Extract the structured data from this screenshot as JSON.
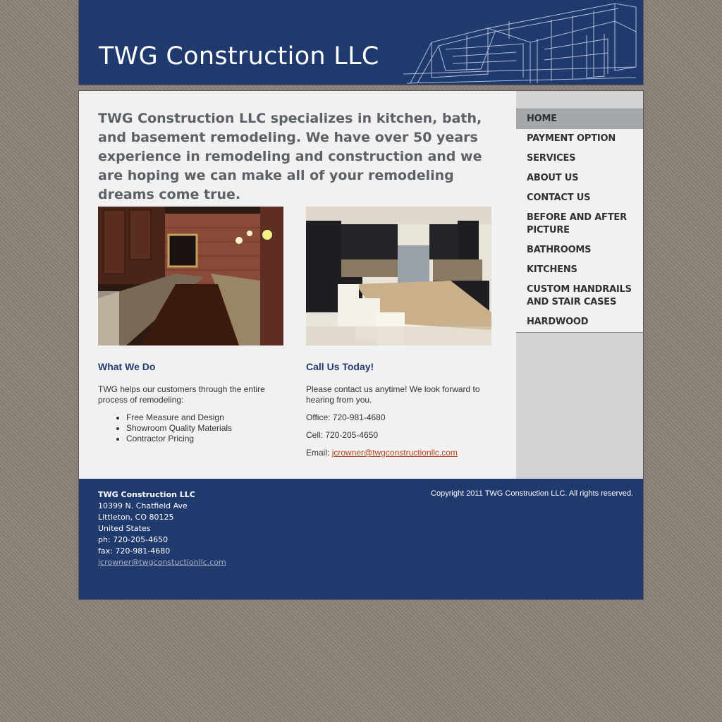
{
  "header": {
    "title": "TWG Construction LLC"
  },
  "intro": "TWG Construction LLC specializes in kitchen, bath, and basement remodeling.  We have over 50 years experience in remodeling and construction and we are hoping we can make all of your remodeling dreams come true.",
  "what_we_do": {
    "heading": "What We Do",
    "text": "TWG helps our customers through the entire process of remodeling:",
    "items": [
      "Free Measure and Design",
      "Showroom Quality Materials",
      "Contractor Pricing"
    ]
  },
  "call_us": {
    "heading": "Call Us Today!",
    "text": "Please contact us anytime! We look forward to hearing from you.",
    "office": "Office: 720-981-4680",
    "cell": "Cell: 720-205-4650",
    "email_label": "Email: ",
    "email": "jcrowner@twgconstructionllc.com"
  },
  "nav": {
    "items": [
      {
        "label": "HOME"
      },
      {
        "label": "PAYMENT OPTION"
      },
      {
        "label": "SERVICES"
      },
      {
        "label": "ABOUT US"
      },
      {
        "label": "CONTACT US"
      },
      {
        "label": "BEFORE AND AFTER PICTURE"
      },
      {
        "label": "BATHROOMS"
      },
      {
        "label": "KITCHENS"
      },
      {
        "label": "CUSTOM HANDRAILS AND STAIR CASES"
      },
      {
        "label": "HARDWOOD"
      }
    ],
    "active": "HOME"
  },
  "footer": {
    "company": "TWG Construction LLC",
    "street": "10399 N. Chatfield Ave",
    "city": "Littleton, CO 80125",
    "country": "United States",
    "phone": "ph: 720-205-4650",
    "fax": "fax: 720-981-4680",
    "email": "jcrowner@twgconstuctionllc.com",
    "copyright": "Copyright 2011 TWG Construction LLC. All rights reserved."
  },
  "colors": {
    "brand_blue": "#213a6e",
    "link": "#b0461c",
    "page_bg": "#8b8278"
  }
}
